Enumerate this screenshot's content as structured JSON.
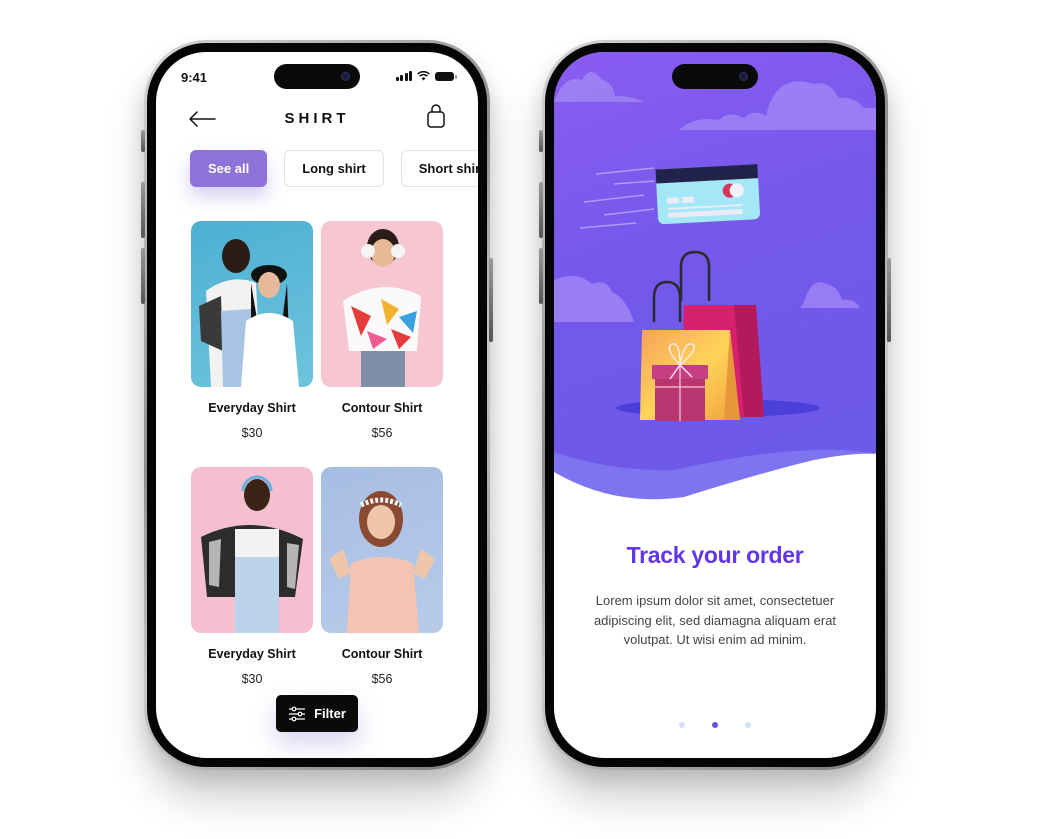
{
  "left_screen": {
    "status_bar": {
      "time": "9:41"
    },
    "header": {
      "title": "SHIRT",
      "back_icon": "arrow-left-icon",
      "cart_icon": "shopping-bag-icon"
    },
    "categories": [
      {
        "label": "See all",
        "active": true
      },
      {
        "label": "Long shirt",
        "active": false
      },
      {
        "label": "Short shirt",
        "active": false
      }
    ],
    "products": [
      {
        "name": "Everyday Shirt",
        "price": "$30",
        "image_bg": "#5bb8d6"
      },
      {
        "name": "Contour Shirt",
        "price": "$56",
        "image_bg": "#f6c3d1"
      },
      {
        "name": "Everyday Shirt",
        "price": "$30",
        "image_bg": "#f6bfd0"
      },
      {
        "name": "Contour Shirt",
        "price": "$56",
        "image_bg": "#a9bfe3"
      }
    ],
    "filter_button": {
      "label": "Filter",
      "icon": "sliders-icon"
    },
    "accent_color": "#8d72d9"
  },
  "right_screen": {
    "title": "Track your order",
    "description": "Lorem ipsum dolor sit amet, consectetuer adipiscing elit, sed diamagna aliquam erat volutpat. Ut wisi enim ad minim.",
    "pagination": {
      "total": 3,
      "active_index": 1
    },
    "title_color": "#6236e8",
    "hero_color": "#7458ec"
  }
}
